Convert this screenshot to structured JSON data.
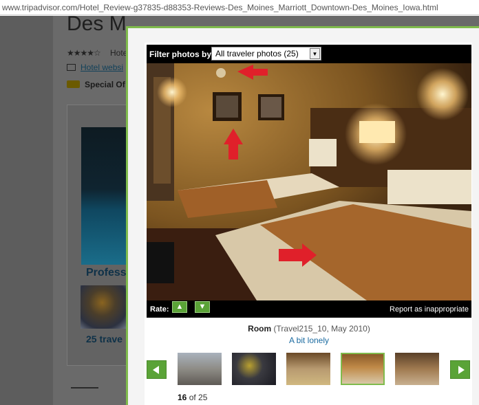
{
  "browser": {
    "url": "www.tripadvisor.com/Hotel_Review-g37835-d88353-Reviews-Des_Moines_Marriott_Downtown-Des_Moines_Iowa.html"
  },
  "background_page": {
    "title": "Des M",
    "stars": "★★★★☆",
    "rating_label": "Hote",
    "hotel_website": "Hotel websi",
    "special_offer": "Special Of",
    "photo_link": "Profess",
    "traveler_link": "25 trave"
  },
  "modal": {
    "filter_label": "Filter photos by",
    "filter_value": "All traveler photos (25)",
    "rate_label": "Rate:",
    "report_link": "Report as inappropriate",
    "caption_title": "Room",
    "caption_meta": "(Travel215_10, May 2010)",
    "caption_text": "A bit lonely",
    "counter_current": "16",
    "counter_rest": "of 25",
    "thumbnails": [
      "thumb-1",
      "thumb-2",
      "thumb-3",
      "thumb-4",
      "thumb-5"
    ],
    "selected_thumbnail": 4
  },
  "colors": {
    "accent": "#7fbb4c",
    "button": "#5aa337",
    "arrow": "#e0202a"
  }
}
